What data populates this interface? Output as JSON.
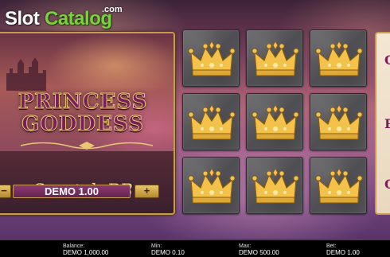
{
  "watermark": {
    "brand_slot": "Slot",
    "brand_catalog": "Catalog",
    "brand_com": ".com"
  },
  "game": {
    "title_line1": "PRINCESS",
    "title_line2": "GODDESS",
    "subtitle": "Scratch BB"
  },
  "bet": {
    "minus_label": "−",
    "value": "DEMO 1.00",
    "plus_label": "+"
  },
  "grid": {
    "rows": 3,
    "cols": 3,
    "tiles": [
      {
        "symbol": "crown-icon"
      },
      {
        "symbol": "crown-icon"
      },
      {
        "symbol": "crown-icon"
      },
      {
        "symbol": "crown-icon"
      },
      {
        "symbol": "crown-icon"
      },
      {
        "symbol": "crown-icon"
      },
      {
        "symbol": "crown-icon"
      },
      {
        "symbol": "crown-icon"
      },
      {
        "symbol": "crown-icon"
      }
    ]
  },
  "right_panel": {
    "glyph_top": "C",
    "glyph_mid": "P",
    "glyph_bottom": "G"
  },
  "status": {
    "balance_label": "Balance:",
    "balance_value": "DEMO 1,000.00",
    "min_label": "Min:",
    "min_value": "DEMO 0.10",
    "max_label": "Max:",
    "max_value": "DEMO 500.00",
    "bet_label": "Bet:",
    "bet_value": "DEMO 1.00"
  },
  "colors": {
    "accent_gold": "#c89c4f",
    "bet_bar": "#8c3a72",
    "crown_gold": "#f2c24a",
    "tile_gray": "#58585c"
  }
}
